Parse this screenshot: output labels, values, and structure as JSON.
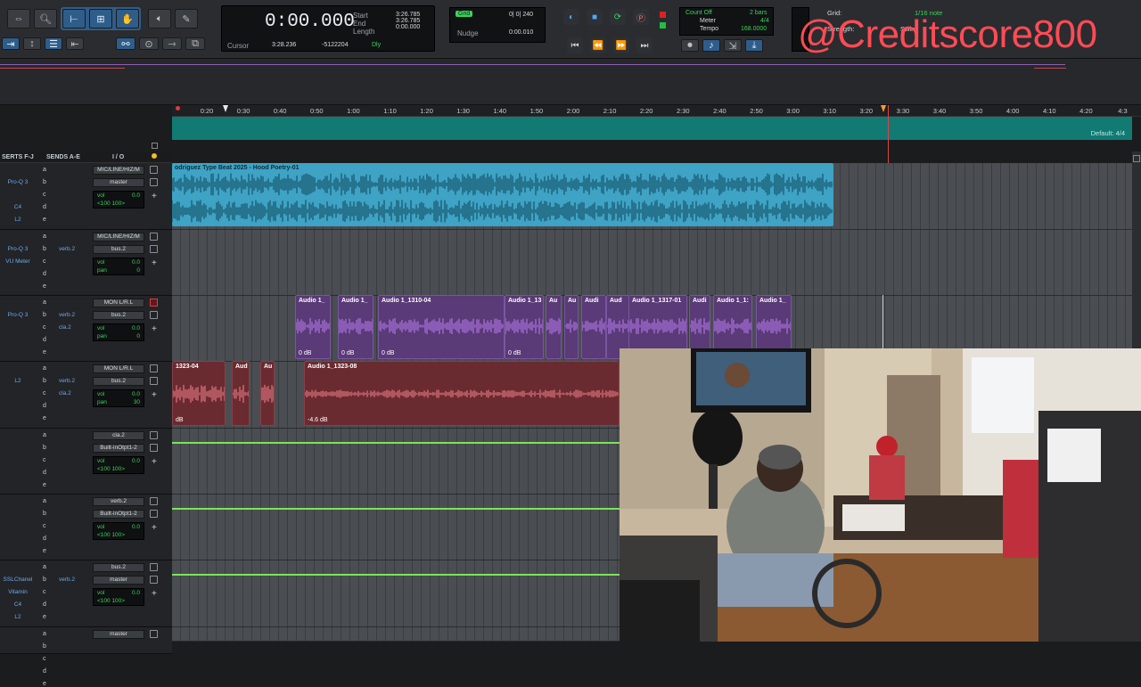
{
  "watermark": "@Creditscore800",
  "counter": {
    "main": "0:00.000",
    "cursor_label": "Cursor",
    "cursor_value": "3:28.236",
    "cursor_sample": "-5122204",
    "start_label": "Start",
    "start": "3:26.785",
    "end_label": "End",
    "end": "3:26.785",
    "length_label": "Length",
    "length": "0:00.000",
    "dly": "Dly"
  },
  "grid_nudge": {
    "grid_label": "Grid",
    "grid_value": "0| 0| 240",
    "nudge_label": "Nudge",
    "nudge_value": "0:00.010"
  },
  "meter_tempo": {
    "countoff": "Count Off",
    "countoff_value": "2 bars",
    "meter_label": "Meter",
    "meter_value": "4/4",
    "tempo_label": "Tempo",
    "tempo_value": "168.0000"
  },
  "snap": {
    "grid_label": "Grid:",
    "grid_value": "1/16 note",
    "strength": "Strength:",
    "swing": "Swing"
  },
  "ruler_ticks": [
    "0:20",
    "0:30",
    "0:40",
    "0:50",
    "1:00",
    "1:10",
    "1:20",
    "1:30",
    "1:40",
    "1:50",
    "2:00",
    "2:10",
    "2:20",
    "2:30",
    "2:40",
    "2:50",
    "3:00",
    "3:10",
    "3:20",
    "3:30",
    "3:40",
    "3:50",
    "4:00",
    "4:10",
    "4:20",
    "4:3"
  ],
  "meter_lane_text": "Default: 4/4",
  "mix_header": [
    "SERTS F-J",
    "SENDS A-E",
    "I / O"
  ],
  "tracks": [
    {
      "plugins": [
        "Pro-Q 3",
        "",
        "C4",
        "L2"
      ],
      "sends": [
        "",
        "",
        "",
        "",
        ""
      ],
      "io": [
        "MIC/LINE/HIZ/M",
        "master"
      ],
      "vol": "vol",
      "vol_val": "0.0",
      "pan": "<100  100>"
    },
    {
      "plugins": [
        "Pro-Q 3",
        "VU Meter"
      ],
      "sends": [
        "verb.2"
      ],
      "io": [
        "MIC/LINE/HIZ/M",
        "bus.2"
      ],
      "vol": "vol",
      "vol_val": "0.0",
      "pan": "pan",
      "pan_val": "0"
    },
    {
      "plugins": [
        "Pro-Q 3"
      ],
      "sends": [
        "verb.2",
        "cla.2"
      ],
      "io": [
        "MON L/R.L",
        "bus.2"
      ],
      "vol": "vol",
      "vol_val": "0.0",
      "pan": "pan",
      "pan_val": "0"
    },
    {
      "plugins": [
        "L2"
      ],
      "sends": [
        "verb.2",
        "cla.2"
      ],
      "io": [
        "MON L/R.L",
        "bus.2"
      ],
      "vol": "vol",
      "vol_val": "0.0",
      "pan": "pan",
      "pan_val": "30"
    },
    {
      "plugins": [],
      "sends": [],
      "io": [
        "cla.2",
        "Built-inOtpt1-2"
      ],
      "vol": "vol",
      "vol_val": "0.0",
      "pan": "<100  100>"
    },
    {
      "plugins": [],
      "sends": [],
      "io": [
        "verb.2",
        "Built-inOtpt1-2"
      ],
      "vol": "vol",
      "vol_val": "0.0",
      "pan": "<100  100>"
    },
    {
      "plugins": [
        "SSLChanel",
        "Vitamin",
        "C4",
        "L2"
      ],
      "sends": [
        "verb.2"
      ],
      "io": [
        "bus.2",
        "master"
      ],
      "vol": "vol",
      "vol_val": "0.0",
      "pan": "<100  100>"
    },
    {
      "plugins": [],
      "sends": [],
      "io": [
        "master"
      ],
      "vol": "",
      "vol_val": "",
      "pan": ""
    }
  ],
  "clips": {
    "beat": {
      "name": "odriguez Type Beat 2025 - Hood Poetry-01"
    },
    "t3": [
      {
        "name": "Audio 1_",
        "db": "0 dB"
      },
      {
        "name": "Audio 1_",
        "db": "0 dB"
      },
      {
        "name": "Audio 1_1310-04",
        "db": "0 dB"
      },
      {
        "name": "Audio 1_13",
        "db": "0 dB"
      },
      {
        "name": "Au",
        "db": ""
      },
      {
        "name": "Au",
        "db": ""
      },
      {
        "name": "Audi",
        "db": ""
      },
      {
        "name": "Aud",
        "db": ""
      },
      {
        "name": "Audio 1_1317-01",
        "db": ""
      },
      {
        "name": "Audi",
        "db": ""
      },
      {
        "name": "Audio 1_1:",
        "db": ""
      },
      {
        "name": "Audio 1_",
        "db": ""
      }
    ],
    "t4": [
      {
        "name": "1323-04",
        "db": "dB"
      },
      {
        "name": "Aud",
        "db": ""
      },
      {
        "name": "Au",
        "db": ""
      },
      {
        "name": "Audio 1_1323-08",
        "db": "-4.6 dB"
      }
    ]
  }
}
